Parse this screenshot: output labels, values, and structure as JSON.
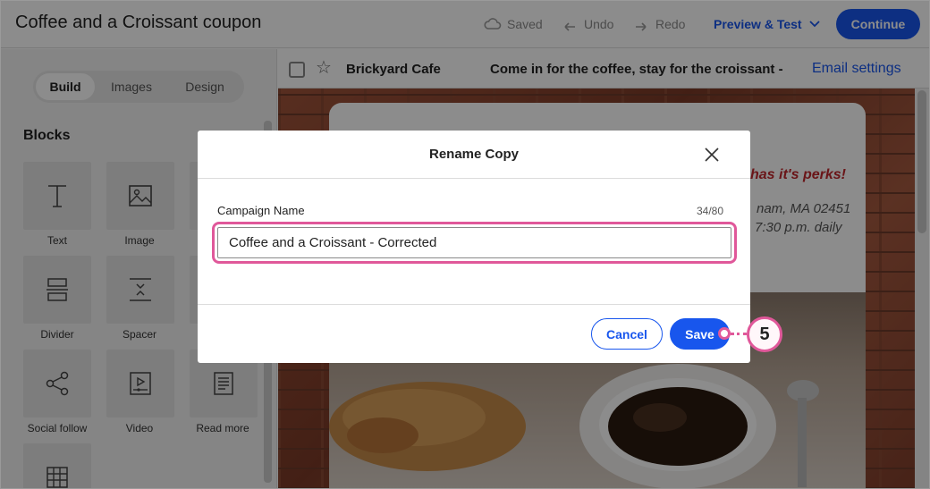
{
  "topbar": {
    "title": "Coffee and a Croissant coupon",
    "saved_label": "Saved",
    "undo_label": "Undo",
    "redo_label": "Redo",
    "preview_label": "Preview & Test",
    "continue_label": "Continue"
  },
  "left_panel": {
    "tabs": [
      {
        "label": "Build",
        "active": true
      },
      {
        "label": "Images",
        "active": false
      },
      {
        "label": "Design",
        "active": false
      }
    ],
    "blocks_title": "Blocks",
    "blocks": [
      {
        "label": "Text",
        "icon": "text-icon"
      },
      {
        "label": "Image",
        "icon": "image-icon"
      },
      {
        "label": "Divider",
        "icon": "divider-icon"
      },
      {
        "label": "Spacer",
        "icon": "spacer-icon"
      },
      {
        "label": "Social follow",
        "icon": "share-icon"
      },
      {
        "label": "Video",
        "icon": "video-icon"
      },
      {
        "label": "Read more",
        "icon": "document-icon"
      },
      {
        "label": "",
        "icon": "table-icon"
      }
    ]
  },
  "email_header": {
    "sender": "Brickyard Cafe",
    "subject": "Come in for the coffee, stay for the croissant -",
    "settings_link": "Email settings"
  },
  "email_preview": {
    "tagline_fragment": "has it's perks!",
    "address_fragment": "nam, MA 02451",
    "hours_fragment": "7:30 p.m. daily"
  },
  "modal": {
    "title": "Rename Copy",
    "field_label": "Campaign Name",
    "char_count": "34/80",
    "input_value": "Coffee and a Croissant - Corrected",
    "cancel_label": "Cancel",
    "save_label": "Save"
  },
  "callout": {
    "step": "5"
  },
  "colors": {
    "accent": "#1856ed",
    "highlight": "#e0589a"
  }
}
